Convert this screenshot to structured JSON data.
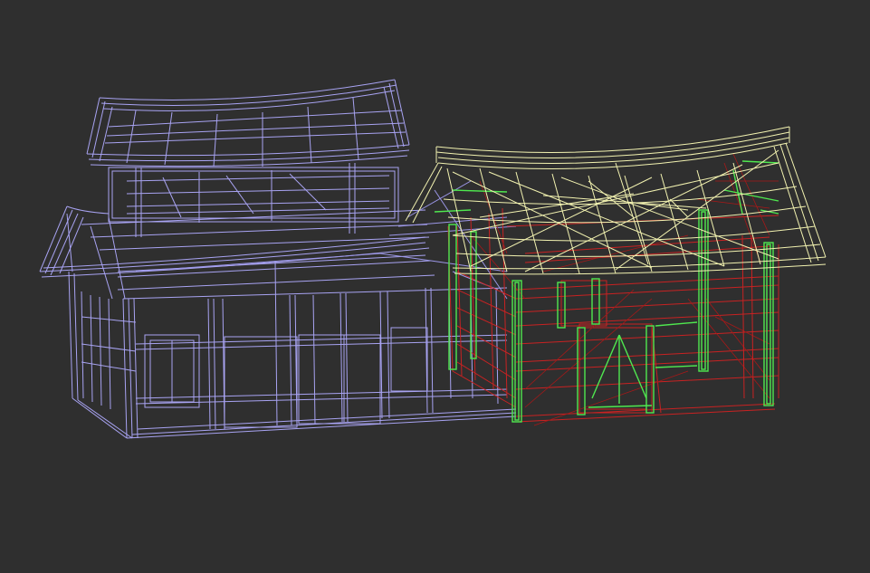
{
  "viewport": {
    "background": "#2f2f2f",
    "render_mode": "wireframe"
  },
  "objects": [
    {
      "name": "main-hall",
      "wire_color": "#a8a3f2",
      "selected": false
    },
    {
      "name": "side-hall-roof",
      "wire_color": "#f2f2b0",
      "selected": true
    },
    {
      "name": "side-hall-columns",
      "wire_color": "#4fe84f",
      "selected": true
    },
    {
      "name": "side-hall-frame",
      "wire_color": "#c92222",
      "selected": true
    }
  ]
}
